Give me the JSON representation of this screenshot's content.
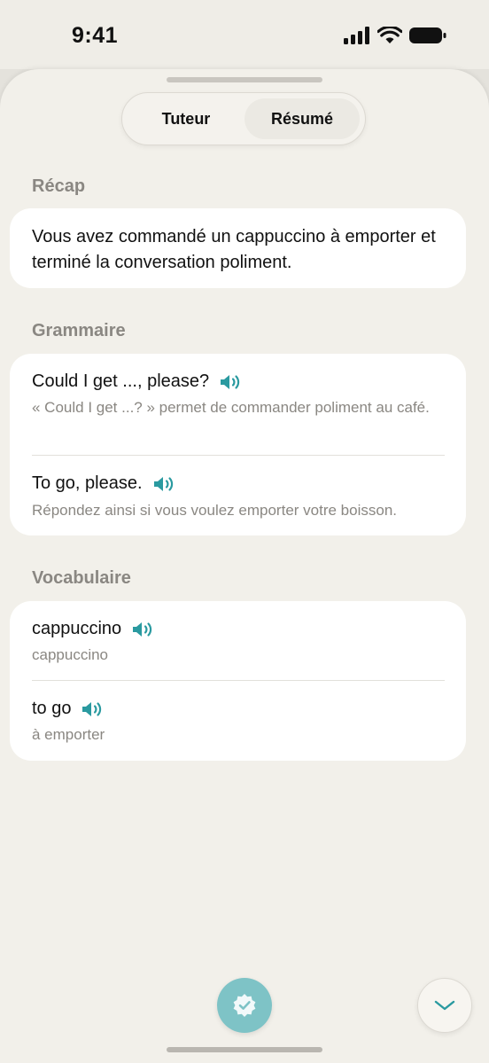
{
  "status_bar": {
    "time": "9:41"
  },
  "tabs": [
    {
      "label": "Tuteur",
      "selected": false
    },
    {
      "label": "Résumé",
      "selected": true
    }
  ],
  "recap": {
    "heading": "Récap",
    "text": "Vous avez commandé un cappuccino à emporter et terminé la conversation poliment."
  },
  "grammar": {
    "heading": "Grammaire",
    "items": [
      {
        "phrase": "Could I get ..., please?",
        "explanation": "« Could I get ...? » permet de commander poliment au café."
      },
      {
        "phrase": "To go, please.",
        "explanation": "Répondez ainsi si vous voulez emporter votre boisson."
      }
    ]
  },
  "vocabulary": {
    "heading": "Vocabulaire",
    "items": [
      {
        "word": "cappuccino",
        "translation": "cappuccino"
      },
      {
        "word": "to go",
        "translation": "à emporter"
      }
    ]
  },
  "icons": {
    "speaker": "speaker-icon",
    "check_badge": "check-badge-icon",
    "chevron_down": "chevron-down-icon"
  },
  "colors": {
    "accent": "#2a9aa0",
    "fab": "#7ec3c6",
    "sheet_bg": "#f2f0ea",
    "card_bg": "#ffffff",
    "muted_text": "#8a8782"
  }
}
